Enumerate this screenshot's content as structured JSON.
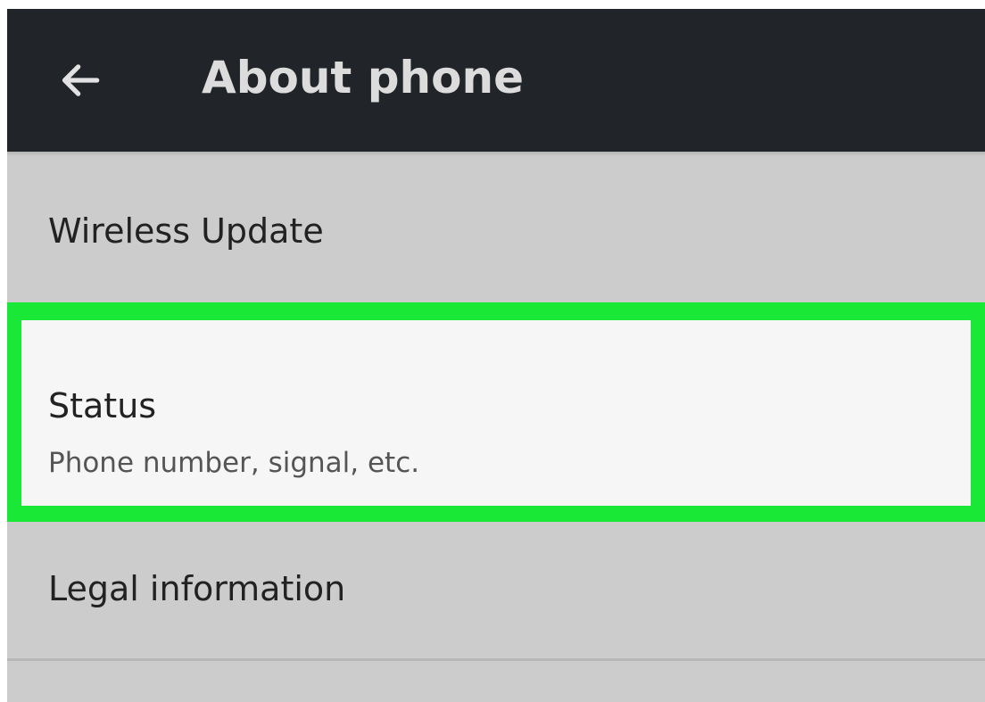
{
  "header": {
    "back_icon": "arrow-back-icon",
    "title": "About phone"
  },
  "settings": {
    "items": [
      {
        "title": "Wireless Update"
      },
      {
        "title": "Status",
        "summary": "Phone number, signal, etc.",
        "highlight_color": "#19e836"
      },
      {
        "title": "Legal information"
      }
    ]
  },
  "colors": {
    "toolbar": "#212529",
    "list_background": "#cccccc",
    "selected_background": "#f6f6f6"
  }
}
